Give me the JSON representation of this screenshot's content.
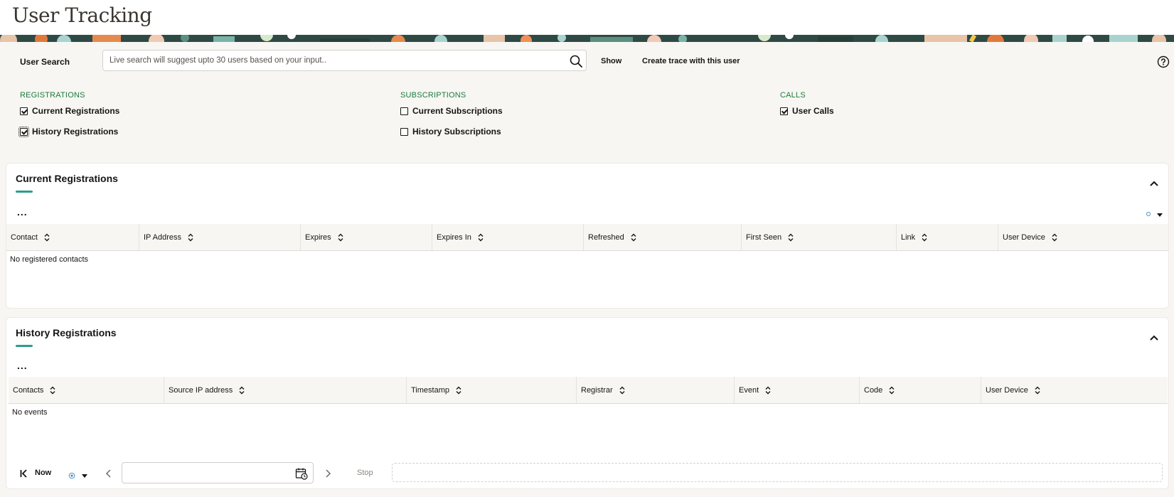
{
  "page": {
    "title": "User Tracking"
  },
  "search": {
    "label": "User Search",
    "placeholder": "Live search will suggest upto 30 users based on your input..",
    "value": "",
    "show_label": "Show",
    "trace_label": "Create trace with this user"
  },
  "groups": {
    "registrations": {
      "title": "REGISTRATIONS",
      "items": [
        {
          "label": "Current Registrations",
          "checked": true
        },
        {
          "label": "History Registrations",
          "checked": true
        }
      ]
    },
    "subscriptions": {
      "title": "SUBSCRIPTIONS",
      "items": [
        {
          "label": "Current Subscriptions",
          "checked": false
        },
        {
          "label": "History Subscriptions",
          "checked": false
        }
      ]
    },
    "calls": {
      "title": "CALLS",
      "items": [
        {
          "label": "User Calls",
          "checked": true
        }
      ]
    }
  },
  "current_panel": {
    "title": "Current Registrations",
    "more": "...",
    "columns": [
      "Contact",
      "IP Address",
      "Expires",
      "Expires In",
      "Refreshed",
      "First Seen",
      "Link",
      "User Device"
    ],
    "empty": "No registered contacts"
  },
  "history_panel": {
    "title": "History Registrations",
    "more": "...",
    "columns": [
      "Contacts",
      "Source IP address",
      "Timestamp",
      "Registrar",
      "Event",
      "Code",
      "User Device"
    ],
    "empty": "No events"
  },
  "toolbar": {
    "now_label": "Now",
    "date_value": "",
    "stop_label": "Stop"
  },
  "icons": {
    "search": "search-icon",
    "help": "help-circle-icon",
    "collapse": "chevron-up-icon",
    "sort": "sort-icon",
    "first": "skip-to-start-icon",
    "prev": "chevron-left-icon",
    "next": "chevron-right-icon",
    "calendar": "calendar-clock-icon",
    "refresh": "refresh-dot-icon",
    "dropdown": "caret-down-icon"
  },
  "colors": {
    "group_title": "#1e7b3d",
    "accent_underline": "#2b9d8d",
    "background": "#f7f6f3"
  }
}
